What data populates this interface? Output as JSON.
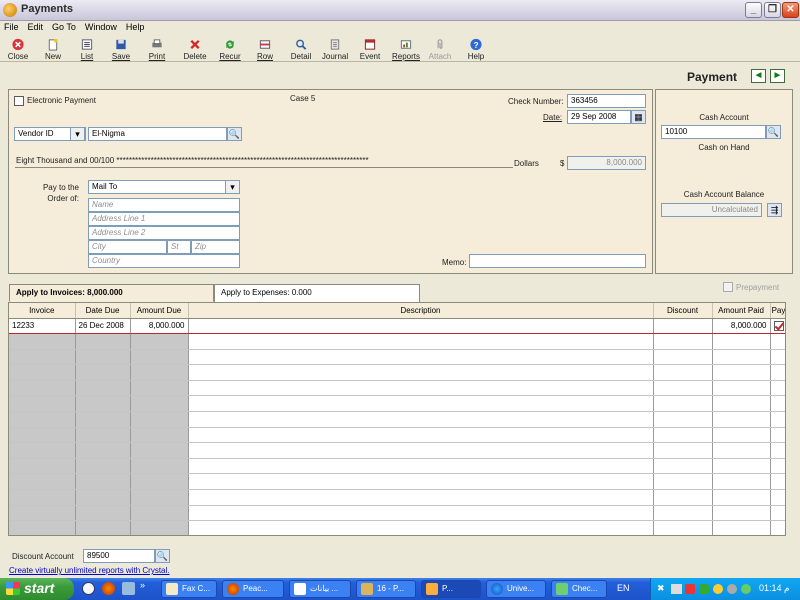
{
  "window": {
    "title": "Payments"
  },
  "menu": [
    "File",
    "Edit",
    "Go To",
    "Window",
    "Help"
  ],
  "toolbar": [
    {
      "label": "Close",
      "icon": "close-icon"
    },
    {
      "label": "New",
      "icon": "new-icon"
    },
    {
      "label": "List",
      "icon": "list-icon"
    },
    {
      "label": "Save",
      "icon": "save-icon"
    },
    {
      "label": "Print",
      "icon": "print-icon"
    },
    {
      "label": "Delete",
      "icon": "delete-icon"
    },
    {
      "label": "Recur",
      "icon": "recur-icon"
    },
    {
      "label": "Row",
      "icon": "row-icon"
    },
    {
      "label": "Detail",
      "icon": "detail-icon"
    },
    {
      "label": "Journal",
      "icon": "journal-icon"
    },
    {
      "label": "Event",
      "icon": "event-icon"
    },
    {
      "label": "Reports",
      "icon": "reports-icon"
    },
    {
      "label": "Attach",
      "icon": "attach-icon"
    },
    {
      "label": "Help",
      "icon": "help-icon"
    }
  ],
  "header": {
    "title": "Payment"
  },
  "payment": {
    "electronic_label": "Electronic Payment",
    "case_label": "Case 5",
    "check_number_label": "Check Number:",
    "check_number": "363456",
    "date_label": "Date:",
    "date": "29 Sep 2008",
    "vendor_mode": "Vendor ID",
    "vendor": "El-Nigma",
    "amount_words": "Eight Thousand and 00/100 *********************************************************************************",
    "dollars_label": "Dollars",
    "currency": "$",
    "amount": "8,000.000",
    "pay_to_label": "Pay to the Order of:",
    "mail_to": "Mail To",
    "name_ph": "Name",
    "addr1_ph": "Address Line 1",
    "addr2_ph": "Address Line 2",
    "city_ph": "City",
    "state_ph": "St",
    "zip_ph": "Zip",
    "country_ph": "Country",
    "memo_label": "Memo:",
    "memo": ""
  },
  "cash": {
    "account_label": "Cash Account",
    "account": "10100",
    "account_name": "Cash on Hand",
    "balance_label": "Cash Account Balance",
    "balance": "Uncalculated"
  },
  "tabs": [
    {
      "label": "Apply to Invoices: 8,000.000",
      "active": true
    },
    {
      "label": "Apply to Expenses: 0.000",
      "active": false
    }
  ],
  "prepayment_label": "Prepayment",
  "grid": {
    "columns": [
      "Invoice",
      "Date Due",
      "Amount Due",
      "Description",
      "Discount",
      "Amount Paid",
      "Pay"
    ],
    "rows": [
      {
        "invoice": "12233",
        "date_due": "26 Dec 2008",
        "amount_due": "8,000.000",
        "description": "",
        "discount": "",
        "amount_paid": "8,000.000",
        "pay": true
      }
    ],
    "empty_rows": 13
  },
  "footer": {
    "discount_label": "Discount Account",
    "discount_account": "89500",
    "link": "Create virtually unlimited reports with Crystal."
  },
  "taskbar": {
    "start": "start",
    "tasks": [
      {
        "label": "Fax C..."
      },
      {
        "label": "Peac..."
      },
      {
        "label": "بيانات ..."
      },
      {
        "label": "16 - P..."
      },
      {
        "label": "P...",
        "active": true
      },
      {
        "label": "Unive..."
      },
      {
        "label": "Chec..."
      }
    ],
    "lang": "EN",
    "clock": "01:14 م"
  },
  "colors": {
    "accent_red": "#c0282c",
    "panel": "#f5ecd9",
    "taskbar": "#245edb"
  }
}
